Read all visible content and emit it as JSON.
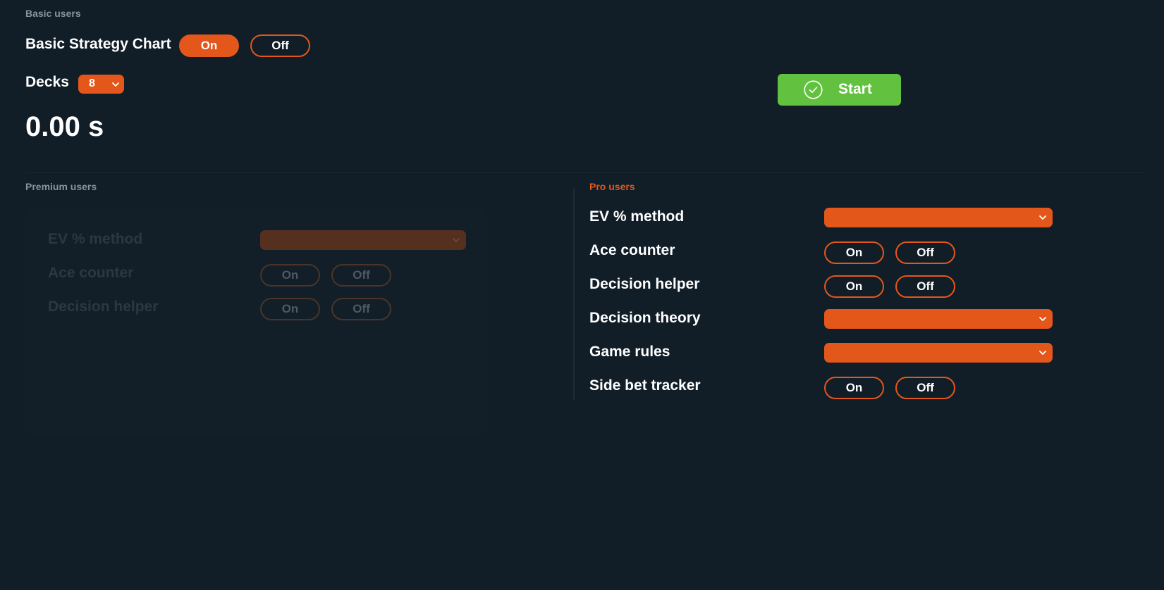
{
  "basic": {
    "section_label": "Basic users",
    "strategy_label": "Basic Strategy Chart",
    "strategy_on": "On",
    "strategy_off": "Off",
    "strategy_selected": "On",
    "decks_label": "Decks",
    "decks_value": "8",
    "timer": "0.00 s",
    "start_label": "Start"
  },
  "premium": {
    "section_label": "Premium users",
    "locked": true,
    "rows": [
      {
        "label": "EV % method",
        "control": "select",
        "value": ""
      },
      {
        "label": "Ace counter",
        "control": "toggle",
        "on": "On",
        "off": "Off"
      },
      {
        "label": "Decision helper",
        "control": "toggle",
        "on": "On",
        "off": "Off"
      }
    ]
  },
  "pro": {
    "section_label": "Pro users",
    "rows": [
      {
        "label": "EV % method",
        "control": "select",
        "value": ""
      },
      {
        "label": "Ace counter",
        "control": "toggle",
        "on": "On",
        "off": "Off"
      },
      {
        "label": "Decision helper",
        "control": "toggle",
        "on": "On",
        "off": "Off"
      },
      {
        "label": "Decision theory",
        "control": "select",
        "value": ""
      },
      {
        "label": "Game rules",
        "control": "select",
        "value": ""
      },
      {
        "label": "Side bet tracker",
        "control": "toggle",
        "on": "On",
        "off": "Off"
      }
    ]
  },
  "colors": {
    "background": "#111d27",
    "accent": "#e4571b",
    "start_green": "#62c23f",
    "muted_label": "#8a939b"
  },
  "icons": {
    "start": "check-circle-icon",
    "dropdown": "chevron-down-icon"
  }
}
